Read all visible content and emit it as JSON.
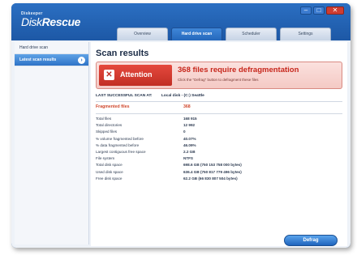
{
  "app": {
    "brand_small": "Diskeeper",
    "brand_main_a": "Disk",
    "brand_main_b": "Rescue"
  },
  "window_controls": {
    "minimize": "–",
    "maximize": "□",
    "close": "✕"
  },
  "tabs": [
    {
      "label": "Overview",
      "active": false
    },
    {
      "label": "Hard drive scan",
      "active": true
    },
    {
      "label": "Scheduler",
      "active": false
    },
    {
      "label": "Settings",
      "active": false
    }
  ],
  "sidebar": {
    "items": [
      {
        "label": "Hard drive scan",
        "active": false
      },
      {
        "label": "Latest scan results",
        "active": true,
        "icon": "chevron-right-icon"
      }
    ]
  },
  "main": {
    "title": "Scan results",
    "alert": {
      "badge": "Attention",
      "headline": "368 files require defragmentation",
      "subtext": "Click the \"Defrag\" button to defragment these files"
    },
    "meta": {
      "status": "LAST SUCCESSFUL SCAN AT:",
      "drive": "Local disk - (C:) Seattle"
    },
    "fragmented": {
      "label": "Fragmented files",
      "value": "368"
    },
    "stats": [
      {
        "label": "Total files",
        "value": "168 915"
      },
      {
        "label": "Total directories",
        "value": "12 992"
      },
      {
        "label": "Skipped files",
        "value": "0"
      },
      {
        "label": "% volume fragmented before",
        "value": "40.07%"
      },
      {
        "label": "% data fragmented before",
        "value": "46.09%"
      },
      {
        "label": "Largest contiguous free space",
        "value": "2.2 GB"
      },
      {
        "label": "File system",
        "value": "NTFS"
      },
      {
        "label": "Total disk space",
        "value": "698.6 GB (750 153 758 000 bytes)"
      },
      {
        "label": "Used disk space",
        "value": "636.4 GB (750 817 779 496 bytes)"
      },
      {
        "label": "Free disk space",
        "value": "62.2 GB (66 830 807 504 bytes)"
      }
    ],
    "defrag_button": "Defrag"
  },
  "colors": {
    "frame": "#1c58a6",
    "alert_red": "#c12e24",
    "accent_blue": "#2e73c7"
  }
}
